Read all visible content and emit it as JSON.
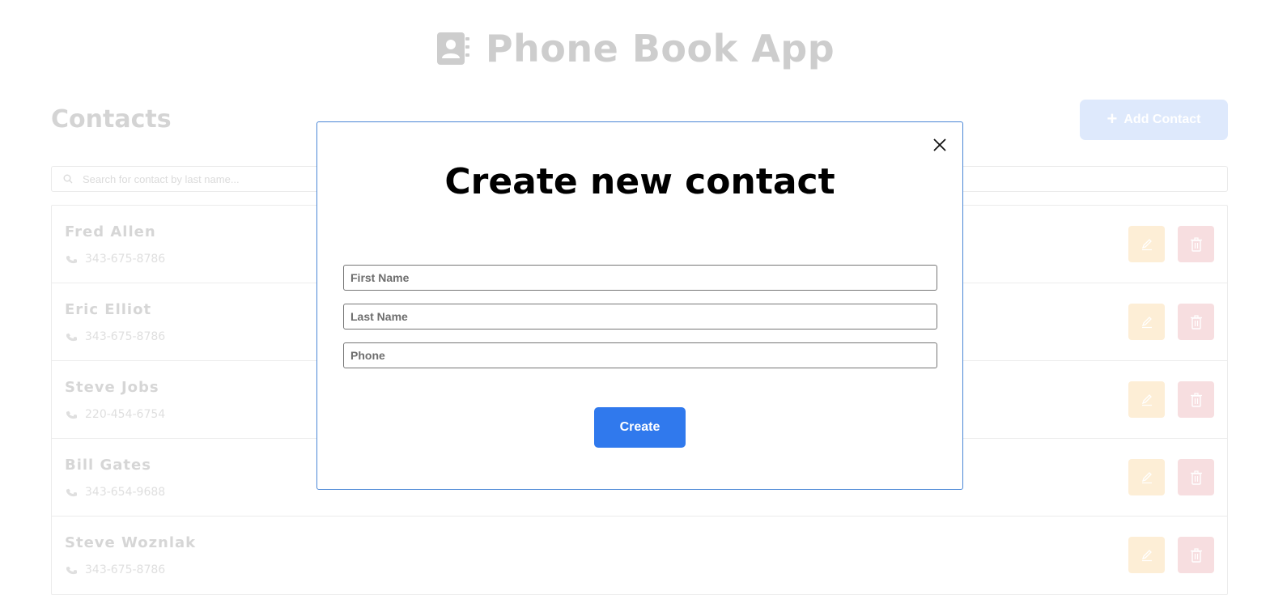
{
  "app": {
    "title": "Phone Book App"
  },
  "contacts": {
    "heading": "Contacts",
    "add_button_label": "Add Contact",
    "search_placeholder": "Search for contact by last name...",
    "items": [
      {
        "name": "Fred Allen",
        "phone": "343-675-8786"
      },
      {
        "name": "Eric Elliot",
        "phone": "343-675-8786"
      },
      {
        "name": "Steve Jobs",
        "phone": "220-454-6754"
      },
      {
        "name": "Bill Gates",
        "phone": "343-654-9688"
      },
      {
        "name": "Steve Woznlak",
        "phone": "343-675-8786"
      }
    ]
  },
  "modal": {
    "title": "Create new contact",
    "first_name_placeholder": "First Name",
    "last_name_placeholder": "Last Name",
    "phone_placeholder": "Phone",
    "create_label": "Create"
  },
  "colors": {
    "accent": "#3079ed",
    "edit": "#fde9c8",
    "delete": "#f5d3d6",
    "muted_text": "#c6c6c6"
  }
}
